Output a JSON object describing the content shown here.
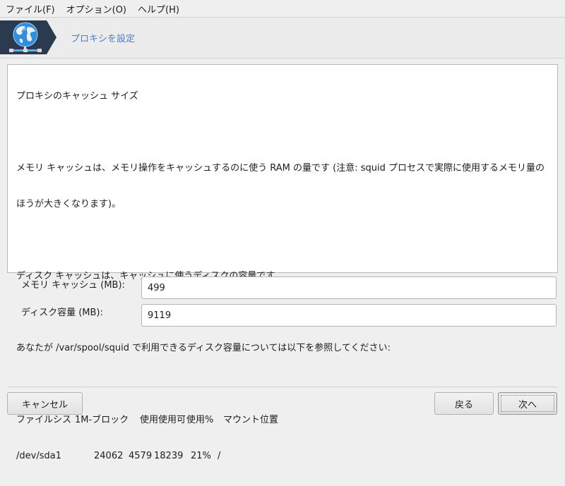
{
  "menubar": {
    "items": [
      "ファイル(F)",
      "オプション(O)",
      "ヘルプ(H)"
    ]
  },
  "header": {
    "title": "プロキシを設定",
    "icon": "globe-network-icon"
  },
  "info": {
    "heading": "プロキシのキャッシュ サイズ",
    "memory_line1": "メモリ キャッシュは、メモリ操作をキャッシュするのに使う RAM の量です (注意: squid プロセスで実際に使用するメモリ量の",
    "memory_line2": "ほうが大きくなります)。",
    "disk_text": "ディスク キャッシュは、キャッシュに使うディスクの容量です。",
    "refer_text": "あなたが /var/spool/squid で利用できるディスク容量については以下を参照してください:",
    "df_header": [
      "ファイルシス",
      "1M-ブロック",
      "使用",
      "使用可",
      "使用%",
      "マウント位置"
    ],
    "df_row": [
      "/dev/sda1",
      "24062",
      "4579",
      "18239",
      "21%",
      "/"
    ]
  },
  "form": {
    "memory_label": "メモリ キャッシュ (MB):",
    "memory_value": "499",
    "disk_label": "ディスク容量 (MB):",
    "disk_value": "9119"
  },
  "buttons": {
    "cancel": "キャンセル",
    "back": "戻る",
    "next": "次へ"
  },
  "colors": {
    "accent": "#4a7fd0",
    "logo_bg": "#2b3a4e"
  }
}
